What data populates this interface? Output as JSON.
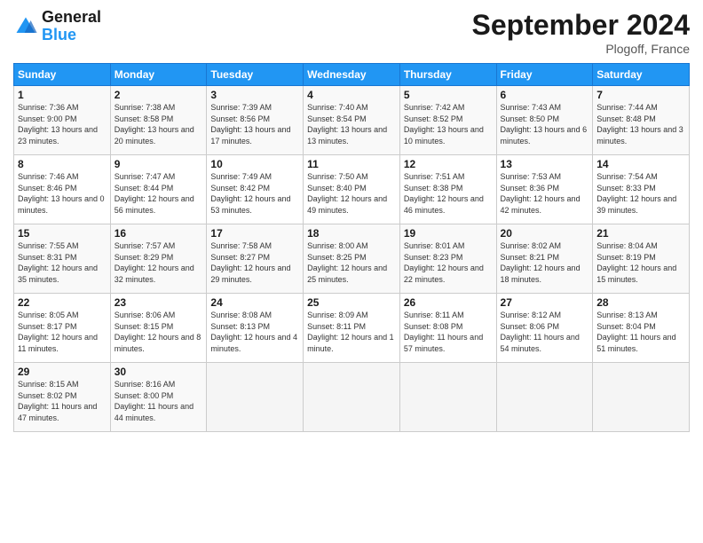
{
  "header": {
    "logo_general": "General",
    "logo_blue": "Blue",
    "month_title": "September 2024",
    "location": "Plogoff, France"
  },
  "weekdays": [
    "Sunday",
    "Monday",
    "Tuesday",
    "Wednesday",
    "Thursday",
    "Friday",
    "Saturday"
  ],
  "weeks": [
    [
      {
        "day": "1",
        "sunrise": "Sunrise: 7:36 AM",
        "sunset": "Sunset: 9:00 PM",
        "daylight": "Daylight: 13 hours and 23 minutes."
      },
      {
        "day": "2",
        "sunrise": "Sunrise: 7:38 AM",
        "sunset": "Sunset: 8:58 PM",
        "daylight": "Daylight: 13 hours and 20 minutes."
      },
      {
        "day": "3",
        "sunrise": "Sunrise: 7:39 AM",
        "sunset": "Sunset: 8:56 PM",
        "daylight": "Daylight: 13 hours and 17 minutes."
      },
      {
        "day": "4",
        "sunrise": "Sunrise: 7:40 AM",
        "sunset": "Sunset: 8:54 PM",
        "daylight": "Daylight: 13 hours and 13 minutes."
      },
      {
        "day": "5",
        "sunrise": "Sunrise: 7:42 AM",
        "sunset": "Sunset: 8:52 PM",
        "daylight": "Daylight: 13 hours and 10 minutes."
      },
      {
        "day": "6",
        "sunrise": "Sunrise: 7:43 AM",
        "sunset": "Sunset: 8:50 PM",
        "daylight": "Daylight: 13 hours and 6 minutes."
      },
      {
        "day": "7",
        "sunrise": "Sunrise: 7:44 AM",
        "sunset": "Sunset: 8:48 PM",
        "daylight": "Daylight: 13 hours and 3 minutes."
      }
    ],
    [
      {
        "day": "8",
        "sunrise": "Sunrise: 7:46 AM",
        "sunset": "Sunset: 8:46 PM",
        "daylight": "Daylight: 13 hours and 0 minutes."
      },
      {
        "day": "9",
        "sunrise": "Sunrise: 7:47 AM",
        "sunset": "Sunset: 8:44 PM",
        "daylight": "Daylight: 12 hours and 56 minutes."
      },
      {
        "day": "10",
        "sunrise": "Sunrise: 7:49 AM",
        "sunset": "Sunset: 8:42 PM",
        "daylight": "Daylight: 12 hours and 53 minutes."
      },
      {
        "day": "11",
        "sunrise": "Sunrise: 7:50 AM",
        "sunset": "Sunset: 8:40 PM",
        "daylight": "Daylight: 12 hours and 49 minutes."
      },
      {
        "day": "12",
        "sunrise": "Sunrise: 7:51 AM",
        "sunset": "Sunset: 8:38 PM",
        "daylight": "Daylight: 12 hours and 46 minutes."
      },
      {
        "day": "13",
        "sunrise": "Sunrise: 7:53 AM",
        "sunset": "Sunset: 8:36 PM",
        "daylight": "Daylight: 12 hours and 42 minutes."
      },
      {
        "day": "14",
        "sunrise": "Sunrise: 7:54 AM",
        "sunset": "Sunset: 8:33 PM",
        "daylight": "Daylight: 12 hours and 39 minutes."
      }
    ],
    [
      {
        "day": "15",
        "sunrise": "Sunrise: 7:55 AM",
        "sunset": "Sunset: 8:31 PM",
        "daylight": "Daylight: 12 hours and 35 minutes."
      },
      {
        "day": "16",
        "sunrise": "Sunrise: 7:57 AM",
        "sunset": "Sunset: 8:29 PM",
        "daylight": "Daylight: 12 hours and 32 minutes."
      },
      {
        "day": "17",
        "sunrise": "Sunrise: 7:58 AM",
        "sunset": "Sunset: 8:27 PM",
        "daylight": "Daylight: 12 hours and 29 minutes."
      },
      {
        "day": "18",
        "sunrise": "Sunrise: 8:00 AM",
        "sunset": "Sunset: 8:25 PM",
        "daylight": "Daylight: 12 hours and 25 minutes."
      },
      {
        "day": "19",
        "sunrise": "Sunrise: 8:01 AM",
        "sunset": "Sunset: 8:23 PM",
        "daylight": "Daylight: 12 hours and 22 minutes."
      },
      {
        "day": "20",
        "sunrise": "Sunrise: 8:02 AM",
        "sunset": "Sunset: 8:21 PM",
        "daylight": "Daylight: 12 hours and 18 minutes."
      },
      {
        "day": "21",
        "sunrise": "Sunrise: 8:04 AM",
        "sunset": "Sunset: 8:19 PM",
        "daylight": "Daylight: 12 hours and 15 minutes."
      }
    ],
    [
      {
        "day": "22",
        "sunrise": "Sunrise: 8:05 AM",
        "sunset": "Sunset: 8:17 PM",
        "daylight": "Daylight: 12 hours and 11 minutes."
      },
      {
        "day": "23",
        "sunrise": "Sunrise: 8:06 AM",
        "sunset": "Sunset: 8:15 PM",
        "daylight": "Daylight: 12 hours and 8 minutes."
      },
      {
        "day": "24",
        "sunrise": "Sunrise: 8:08 AM",
        "sunset": "Sunset: 8:13 PM",
        "daylight": "Daylight: 12 hours and 4 minutes."
      },
      {
        "day": "25",
        "sunrise": "Sunrise: 8:09 AM",
        "sunset": "Sunset: 8:11 PM",
        "daylight": "Daylight: 12 hours and 1 minute."
      },
      {
        "day": "26",
        "sunrise": "Sunrise: 8:11 AM",
        "sunset": "Sunset: 8:08 PM",
        "daylight": "Daylight: 11 hours and 57 minutes."
      },
      {
        "day": "27",
        "sunrise": "Sunrise: 8:12 AM",
        "sunset": "Sunset: 8:06 PM",
        "daylight": "Daylight: 11 hours and 54 minutes."
      },
      {
        "day": "28",
        "sunrise": "Sunrise: 8:13 AM",
        "sunset": "Sunset: 8:04 PM",
        "daylight": "Daylight: 11 hours and 51 minutes."
      }
    ],
    [
      {
        "day": "29",
        "sunrise": "Sunrise: 8:15 AM",
        "sunset": "Sunset: 8:02 PM",
        "daylight": "Daylight: 11 hours and 47 minutes."
      },
      {
        "day": "30",
        "sunrise": "Sunrise: 8:16 AM",
        "sunset": "Sunset: 8:00 PM",
        "daylight": "Daylight: 11 hours and 44 minutes."
      },
      null,
      null,
      null,
      null,
      null
    ]
  ]
}
